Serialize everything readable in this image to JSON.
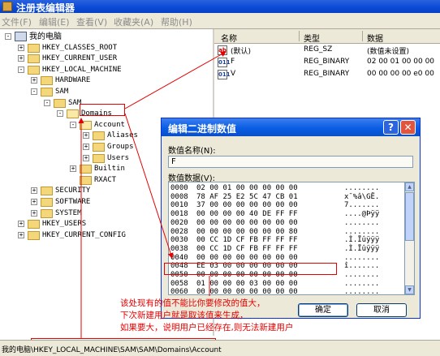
{
  "window": {
    "title": "注册表编辑器"
  },
  "menu": [
    "文件(F)",
    "编辑(E)",
    "查看(V)",
    "收藏夹(A)",
    "帮助(H)"
  ],
  "tree": [
    {
      "label": "我的电脑",
      "kind": "pc",
      "expander": "-"
    },
    {
      "label": "HKEY_CLASSES_ROOT",
      "kind": "folder",
      "expander": "+"
    },
    {
      "label": "HKEY_CURRENT_USER",
      "kind": "folder",
      "expander": "+"
    },
    {
      "label": "HKEY_LOCAL_MACHINE",
      "kind": "folder",
      "expander": "-"
    },
    {
      "label": "HARDWARE",
      "kind": "folder",
      "expander": "+"
    },
    {
      "label": "SAM",
      "kind": "folder",
      "expander": "-"
    },
    {
      "label": "SAM",
      "kind": "folder",
      "expander": "-"
    },
    {
      "label": "Domains",
      "kind": "folder-open",
      "expander": "-"
    },
    {
      "label": "Account",
      "kind": "folder-open",
      "expander": "-"
    },
    {
      "label": "Aliases",
      "kind": "folder",
      "expander": "+"
    },
    {
      "label": "Groups",
      "kind": "folder",
      "expander": "+"
    },
    {
      "label": "Users",
      "kind": "folder",
      "expander": "+"
    },
    {
      "label": "Builtin",
      "kind": "folder",
      "expander": "+"
    },
    {
      "label": "RXACT",
      "kind": "folder",
      "expander": ""
    },
    {
      "label": "SECURITY",
      "kind": "folder",
      "expander": "+"
    },
    {
      "label": "SOFTWARE",
      "kind": "folder",
      "expander": "+"
    },
    {
      "label": "SYSTEM",
      "kind": "folder",
      "expander": "+"
    },
    {
      "label": "HKEY_USERS",
      "kind": "folder",
      "expander": "+"
    },
    {
      "label": "HKEY_CURRENT_CONFIG",
      "kind": "folder",
      "expander": "+"
    }
  ],
  "list": {
    "headers": {
      "name": "名称",
      "type": "类型",
      "data": "数据"
    },
    "rows": [
      {
        "icon": "ab",
        "name": "(默认)",
        "type": "REG_SZ",
        "data": "(数值未设置)"
      },
      {
        "icon": "011",
        "name": "F",
        "type": "REG_BINARY",
        "data": "02 00 01 00 00 00"
      },
      {
        "icon": "011",
        "name": "V",
        "type": "REG_BINARY",
        "data": "00 00 00 00 e0 00"
      }
    ]
  },
  "dialog": {
    "title": "编辑二进制数值",
    "value_name_label": "数值名称(N):",
    "value_name": "F",
    "value_data_label": "数值数据(V):",
    "hex_rows": [
      {
        "offset": "0000",
        "bytes": "02 00 01 00 00 00 00 00",
        "ascii": "........"
      },
      {
        "offset": "0008",
        "bytes": "78 AF 25 E2 5C 47 CB 01",
        "ascii": "x¯%â\\GË."
      },
      {
        "offset": "0010",
        "bytes": "37 00 00 00 00 00 00 00",
        "ascii": "7......."
      },
      {
        "offset": "0018",
        "bytes": "00 00 00 00 40 DE FF FF",
        "ascii": "....@Þÿÿ"
      },
      {
        "offset": "0020",
        "bytes": "00 00 00 00 00 00 00 00",
        "ascii": "........"
      },
      {
        "offset": "0028",
        "bytes": "00 00 00 00 00 00 00 80",
        "ascii": "........"
      },
      {
        "offset": "0030",
        "bytes": "00 CC 1D CF FB FF FF FF",
        "ascii": ".Ì.Ïûÿÿÿ"
      },
      {
        "offset": "0038",
        "bytes": "00 CC 1D CF FB FF FF FF",
        "ascii": ".Ì.Ïûÿÿÿ"
      },
      {
        "offset": "0040",
        "bytes": "00 00 00 00 00 00 00 00",
        "ascii": "........"
      },
      {
        "offset": "0048",
        "bytes": "EE 03 00 00 00 00 00 00",
        "ascii": "î......."
      },
      {
        "offset": "0050",
        "bytes": "00 00 00 00 00 00 00 00",
        "ascii": "........"
      },
      {
        "offset": "0058",
        "bytes": "01 00 00 00 03 00 00 00",
        "ascii": "........"
      },
      {
        "offset": "0060",
        "bytes": "00 00 00 00 00 00 00 00",
        "ascii": "........"
      }
    ],
    "ok_label": "确定",
    "cancel_label": "取消"
  },
  "annotation": [
    "该处现有的值不能比你要修改的值大，",
    "下次新建用户就是取该值来生成，",
    "如果要大，说明用户已经存在,则无法新建用户"
  ],
  "status_path": "我的电脑\\HKEY_LOCAL_MACHINE\\SAM\\SAM\\Domains\\Account",
  "colors": {
    "annotation": "#e60000",
    "title_bar": "#0a49d6",
    "dialog_face": "#ece9d8"
  }
}
